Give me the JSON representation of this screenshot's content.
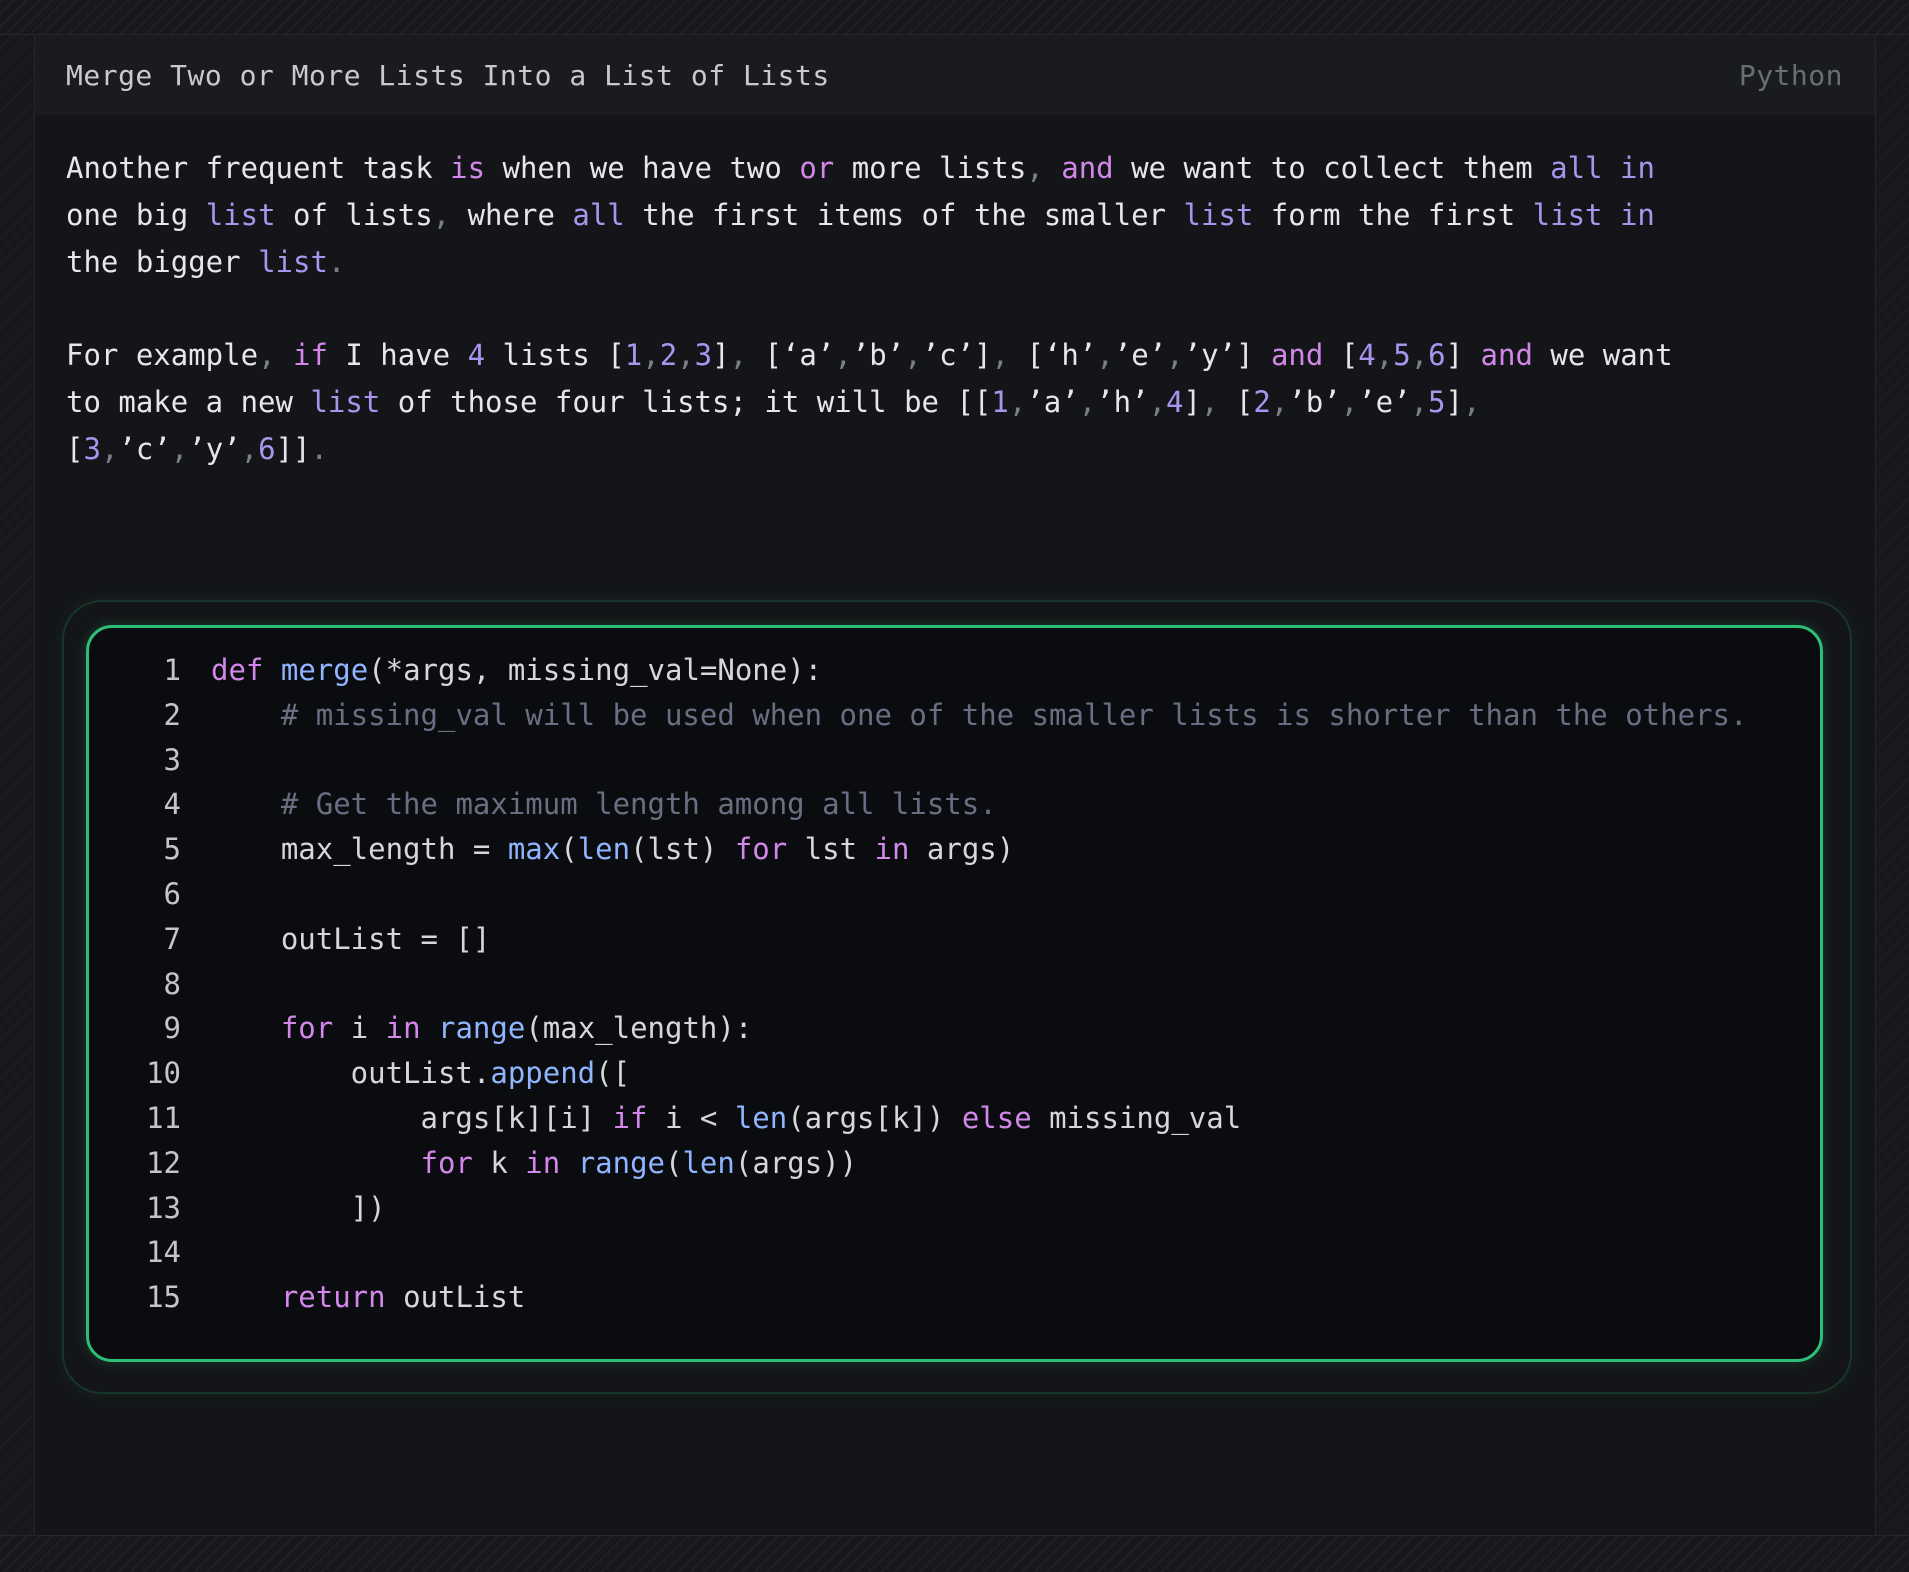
{
  "header": {
    "title": "Merge Two or More Lists Into a List of Lists",
    "language": "Python"
  },
  "paragraph1": {
    "lines": [
      "Another frequent task is when we have two or more lists, and we want to collect them all in",
      "one big list of lists, where all the first items of the smaller list form the first list in",
      "the bigger list."
    ]
  },
  "paragraph2": {
    "lines": [
      "For example, if I have 4 lists [1,2,3], [‘a’,’b’,’c’], [‘h’,’e’,’y’] and [4,5,6] and we want",
      "to make a new list of those four lists; it will be [[1,’a’,’h’,4], [2,’b’,’e’,5],",
      "[3,’c’,’y’,6]]."
    ]
  },
  "code": {
    "line_numbers": [
      "1",
      "2",
      "3",
      "4",
      "5",
      "6",
      "7",
      "8",
      "9",
      "10",
      "11",
      "12",
      "13",
      "14",
      "15"
    ],
    "lines": [
      "def merge(*args, missing_val=None):",
      "    # missing_val will be used when one of the smaller lists is shorter than the others.",
      "",
      "    # Get the maximum length among all lists.",
      "    max_length = max(len(lst) for lst in args)",
      "",
      "    outList = []",
      "",
      "    for i in range(max_length):",
      "        outList.append([",
      "            args[k][i] if i < len(args[k]) else missing_val",
      "            for k in range(len(args))",
      "        ])",
      "",
      "    return outList"
    ]
  },
  "colors": {
    "keyword": "#d387ea",
    "builtin": "#a994ee",
    "function": "#8fb5ff",
    "comment": "#6b6e82",
    "code_border": "#2dbf78"
  }
}
